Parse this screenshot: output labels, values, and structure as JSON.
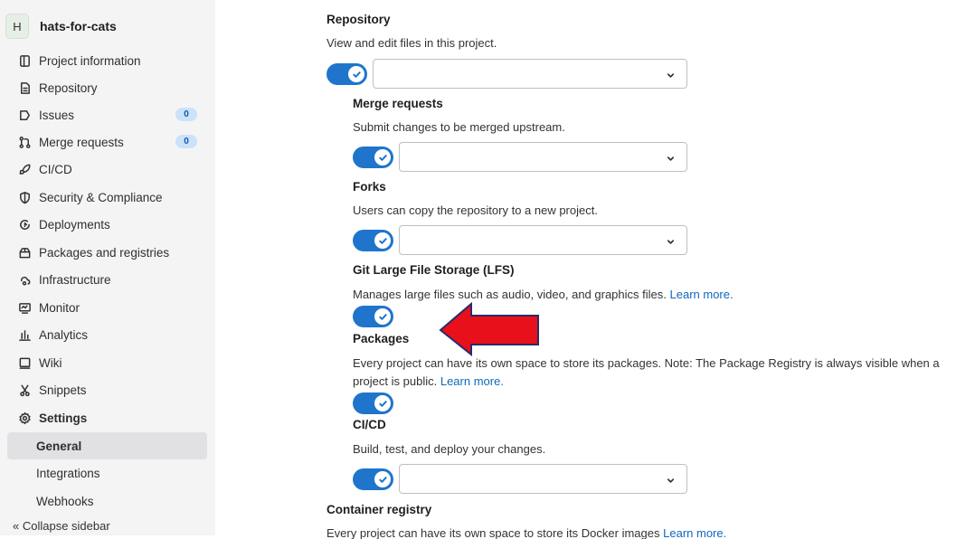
{
  "sidebar": {
    "project_initial": "H",
    "project_name": "hats-for-cats",
    "items": [
      {
        "label": "Project information",
        "icon": "info-book-icon"
      },
      {
        "label": "Repository",
        "icon": "document-icon"
      },
      {
        "label": "Issues",
        "icon": "issues-icon",
        "badge": "0"
      },
      {
        "label": "Merge requests",
        "icon": "merge-request-icon",
        "badge": "0"
      },
      {
        "label": "CI/CD",
        "icon": "rocket-icon"
      },
      {
        "label": "Security & Compliance",
        "icon": "shield-icon"
      },
      {
        "label": "Deployments",
        "icon": "deployments-icon"
      },
      {
        "label": "Packages and registries",
        "icon": "package-icon"
      },
      {
        "label": "Infrastructure",
        "icon": "cloud-gear-icon"
      },
      {
        "label": "Monitor",
        "icon": "monitor-icon"
      },
      {
        "label": "Analytics",
        "icon": "chart-icon"
      },
      {
        "label": "Wiki",
        "icon": "wiki-icon"
      },
      {
        "label": "Snippets",
        "icon": "scissors-icon"
      },
      {
        "label": "Settings",
        "icon": "gear-icon"
      }
    ],
    "settings_sub": [
      "General",
      "Integrations",
      "Webhooks"
    ],
    "collapse_label": "« Collapse sidebar"
  },
  "main": {
    "repository": {
      "title": "Repository",
      "desc": "View and edit files in this project."
    },
    "merge_requests": {
      "title": "Merge requests",
      "desc": "Submit changes to be merged upstream."
    },
    "forks": {
      "title": "Forks",
      "desc": "Users can copy the repository to a new project."
    },
    "lfs": {
      "title": "Git Large File Storage (LFS)",
      "desc": "Manages large files such as audio, video, and graphics files.",
      "link": "Learn more."
    },
    "packages": {
      "title": "Packages",
      "desc_line1": "Every project can have its own space to store its packages. Note: The Package Registry is always visible when a",
      "desc_line2": "project is public.",
      "link": "Learn more."
    },
    "cicd": {
      "title": "CI/CD",
      "desc": "Build, test, and deploy your changes."
    },
    "container_registry": {
      "title": "Container registry",
      "desc": "Every project can have its own space to store its Docker images",
      "link": "Learn more."
    }
  },
  "colors": {
    "toggle_on": "#1f75cb",
    "link": "#1068bf",
    "annotation_arrow": "#e8101a"
  }
}
